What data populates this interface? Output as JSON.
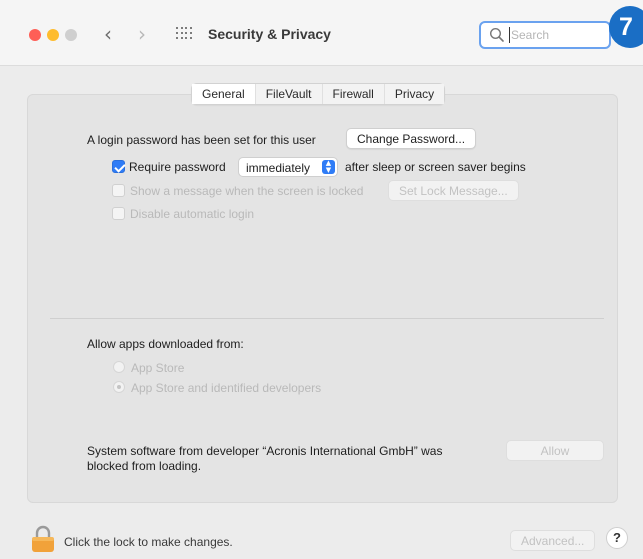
{
  "window": {
    "title": "Security & Privacy",
    "search_placeholder": "Search",
    "step_badge": "7"
  },
  "tabs": [
    {
      "label": "General",
      "active": true
    },
    {
      "label": "FileVault",
      "active": false
    },
    {
      "label": "Firewall",
      "active": false
    },
    {
      "label": "Privacy",
      "active": false
    }
  ],
  "general": {
    "login_text": "A login password has been set for this user",
    "change_password_label": "Change Password...",
    "require_password_label": "Require password",
    "require_password_checked": true,
    "require_password_value": "immediately",
    "after_sleep_text": "after sleep or screen saver begins",
    "show_message_label": "Show a message when the screen is locked",
    "set_lock_message_label": "Set Lock Message...",
    "disable_auto_login_label": "Disable automatic login"
  },
  "apps": {
    "heading": "Allow apps downloaded from:",
    "options": [
      {
        "label": "App Store",
        "selected": false
      },
      {
        "label": "App Store and identified developers",
        "selected": true
      }
    ]
  },
  "blocked": {
    "line1": "System software from developer “Acronis International GmbH” was",
    "line2": "blocked from loading.",
    "allow_label": "Allow"
  },
  "footer": {
    "lock_text": "Click the lock to make changes.",
    "advanced_label": "Advanced...",
    "help_label": "?"
  },
  "colors": {
    "accent": "#2f7cf6",
    "badge": "#1a6ec5",
    "lock": "#f1a23a"
  }
}
